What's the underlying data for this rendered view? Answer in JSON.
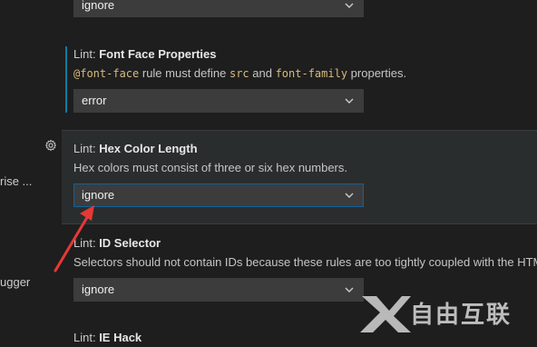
{
  "left_labels": {
    "first": "rise ...",
    "second": "ugger"
  },
  "settings": [
    {
      "value": "ignore"
    },
    {
      "title_prefix": "Lint: ",
      "title_name": "Font Face Properties",
      "desc_parts": [
        "@font-face",
        " rule must define ",
        "src",
        " and ",
        "font-family",
        " properties."
      ],
      "value": "error"
    },
    {
      "title_prefix": "Lint: ",
      "title_name": "Hex Color Length",
      "desc": "Hex colors must consist of three or six hex numbers.",
      "value": "ignore"
    },
    {
      "title_prefix": "Lint: ",
      "title_name": "ID Selector",
      "desc": "Selectors should not contain IDs because these rules are too tightly coupled with the HTML.",
      "value": "ignore"
    },
    {
      "title_prefix": "Lint: ",
      "title_name": "IE Hack"
    }
  ],
  "watermark": {
    "text": "自由互联"
  },
  "colors": {
    "background": "#1e1e1e",
    "accent": "#0e639c",
    "modified_bar": "#0c7d9d",
    "arrow": "#e53935"
  }
}
